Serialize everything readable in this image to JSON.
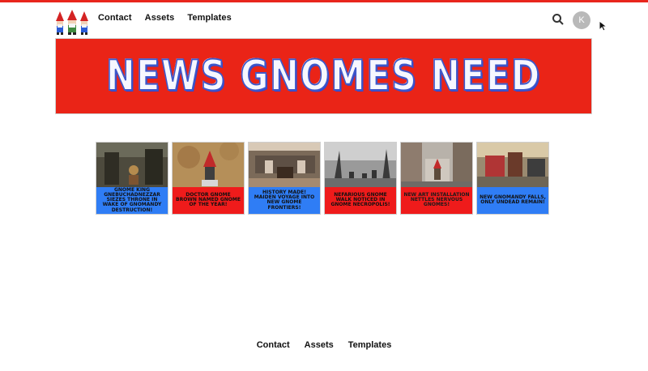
{
  "header": {
    "nav": {
      "contact": "Contact",
      "assets": "Assets",
      "templates": "Templates"
    },
    "avatar_initial": "K",
    "search_icon": "search-icon",
    "cursor_icon": "cursor-icon"
  },
  "banner": {
    "title": "News Gnomes Need"
  },
  "cards": [
    {
      "caption": "Gnome King Gnebuchadnezzar Siezes Throne in Wake of Gnomandy Destruction!"
    },
    {
      "caption": "Doctor Gnome Brown Named Gnome of the Year!"
    },
    {
      "caption": "History Made! Maiden Voyage into New Gnome Frontiers!"
    },
    {
      "caption": "Nefarious Gnome Walk Noticed in Gnome Necropolis!"
    },
    {
      "caption": "New Art Installation Nettles Nervous Gnomes!"
    },
    {
      "caption": "New Gnomandy Falls, Only Undead Remain!"
    }
  ],
  "footer": {
    "contact": "Contact",
    "assets": "Assets",
    "templates": "Templates"
  },
  "colors": {
    "accent_red": "#e8261c",
    "blue": "#2f7df5",
    "banner_red": "#ea2417"
  }
}
